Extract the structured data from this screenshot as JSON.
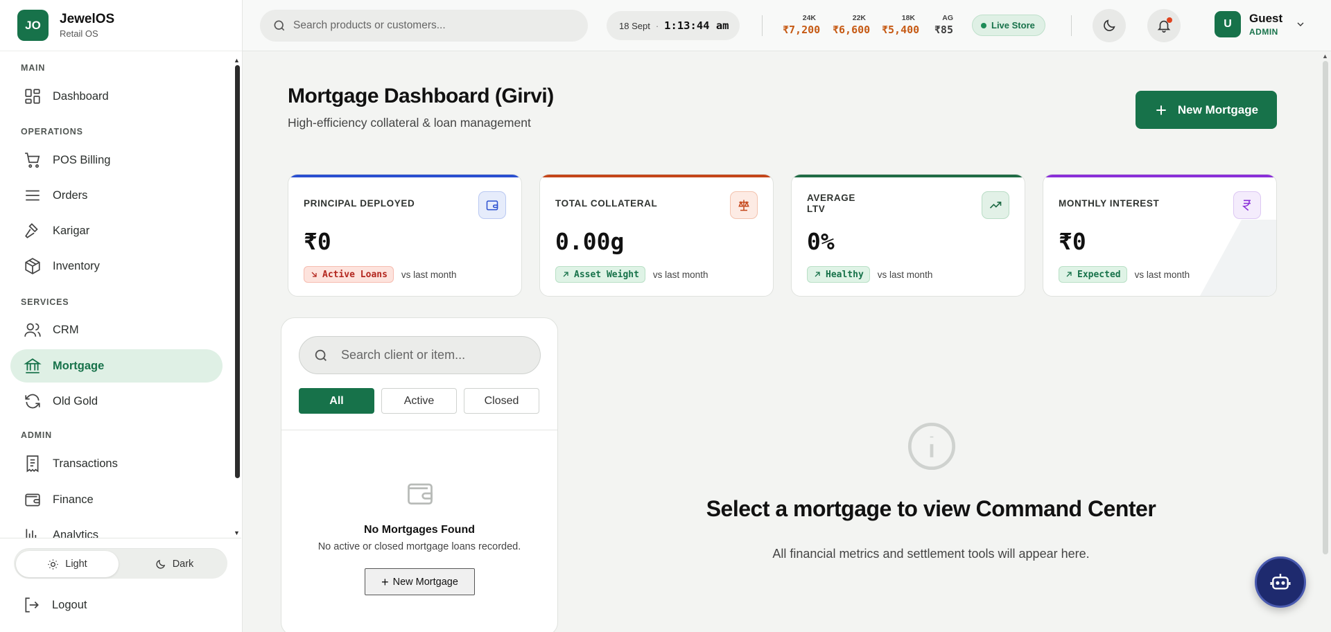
{
  "brand": {
    "logo": "JO",
    "name": "JewelOS",
    "sub": "Retail OS"
  },
  "sidebar": {
    "sections": {
      "main": "MAIN",
      "operations": "OPERATIONS",
      "services": "SERVICES",
      "admin": "ADMIN"
    },
    "items": [
      {
        "label": "Dashboard",
        "icon": "dashboard-icon"
      },
      {
        "label": "POS Billing",
        "icon": "cart-icon"
      },
      {
        "label": "Orders",
        "icon": "list-icon"
      },
      {
        "label": "Karigar",
        "icon": "hammer-icon"
      },
      {
        "label": "Inventory",
        "icon": "box-icon"
      },
      {
        "label": "CRM",
        "icon": "users-icon"
      },
      {
        "label": "Mortgage",
        "icon": "bank-icon",
        "active": true
      },
      {
        "label": "Old Gold",
        "icon": "refresh-icon"
      },
      {
        "label": "Transactions",
        "icon": "receipt-icon"
      },
      {
        "label": "Finance",
        "icon": "wallet-icon"
      },
      {
        "label": "Analytics",
        "icon": "chart-icon"
      }
    ],
    "theme": {
      "light": "Light",
      "dark": "Dark",
      "selected": "Light"
    },
    "logout": "Logout"
  },
  "topbar": {
    "search_placeholder": "Search products or customers...",
    "date": "18 Sept",
    "separator": "·",
    "time": "1:13:44 am",
    "rates": [
      {
        "label": "24K",
        "value": "₹7,200"
      },
      {
        "label": "22K",
        "value": "₹6,600"
      },
      {
        "label": "18K",
        "value": "₹5,400"
      },
      {
        "label": "AG",
        "value": "₹85"
      }
    ],
    "live_label": "Live Store",
    "user": {
      "initial": "U",
      "name": "Guest",
      "role": "ADMIN"
    }
  },
  "page": {
    "title": "Mortgage Dashboard (Girvi)",
    "subtitle": "High-efficiency collateral & loan management",
    "new_button": "New Mortgage"
  },
  "stats": [
    {
      "label": "PRINCIPAL DEPLOYED",
      "value": "₹0",
      "chip": "Active Loans",
      "vs": "vs last month",
      "accent": "#2a4fd0"
    },
    {
      "label": "TOTAL COLLATERAL",
      "value": "0.00g",
      "chip": "Asset Weight",
      "vs": "vs last month",
      "accent": "#c4461a"
    },
    {
      "label": "AVERAGE LTV",
      "value": "0%",
      "chip": "Healthy",
      "vs": "vs last month",
      "accent": "#1f6b45"
    },
    {
      "label": "MONTHLY INTEREST",
      "value": "₹0",
      "chip": "Expected",
      "vs": "vs last month",
      "accent": "#8a2fd8"
    }
  ],
  "list": {
    "search_placeholder": "Search client or item...",
    "filters": [
      "All",
      "Active",
      "Closed"
    ],
    "selected_filter": "All",
    "empty_title": "No Mortgages Found",
    "empty_sub": "No active or closed mortgage loans recorded.",
    "empty_button": "New Mortgage"
  },
  "command_center": {
    "title": "Select a mortgage to view Command Center",
    "subtitle": "All financial metrics and settlement tools will appear here."
  },
  "colors": {
    "brand": "#17724a",
    "active_bg": "#dff0e5",
    "gold_rate": "#c65a14",
    "bot": "#1e2a6e"
  }
}
